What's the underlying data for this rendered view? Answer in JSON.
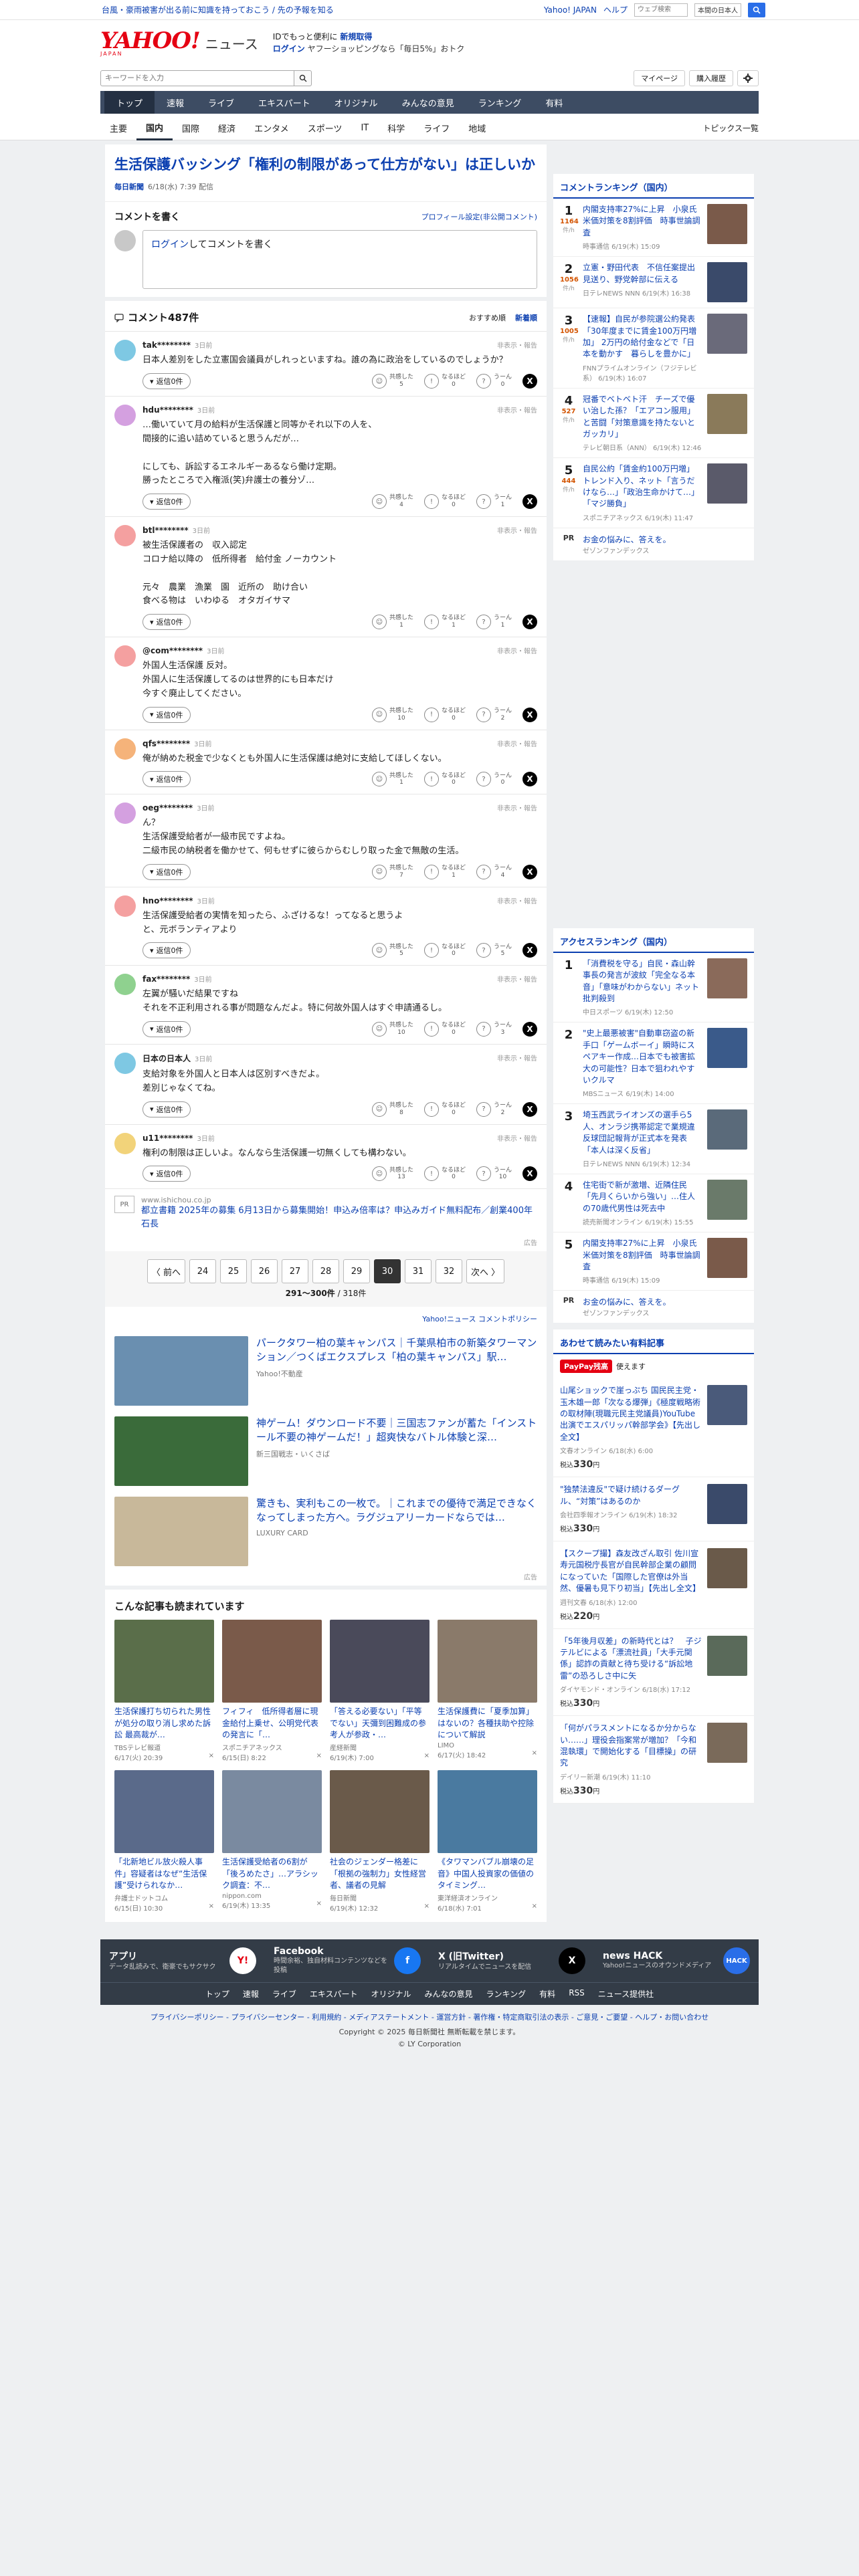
{
  "topbar": {
    "notice": "台風・豪雨被害が出る前に知識を持っておこう / 先の予報を知る",
    "yahoo_japan": "Yahoo! JAPAN",
    "help": "ヘルプ",
    "search_placeholder": "ウェブ検索",
    "scope": "本間の日本人"
  },
  "masthead": {
    "logo": "YAHOO!",
    "logo_sub": "JAPAN",
    "news": "ニュース",
    "promo_line1": "IDでもっと便利に",
    "promo_new": "新規取得",
    "promo_login": "ログイン",
    "promo_line2": "ヤフーショッピングなら「毎日5%」おトク"
  },
  "search": {
    "placeholder": "キーワードを入力",
    "mypage": "マイページ",
    "history": "購入履歴"
  },
  "global_nav": [
    "トップ",
    "速報",
    "ライブ",
    "エキスパート",
    "オリジナル",
    "みんなの意見",
    "ランキング",
    "有料"
  ],
  "sub_nav": [
    "主要",
    "国内",
    "国際",
    "経済",
    "エンタメ",
    "スポーツ",
    "IT",
    "科学",
    "ライフ",
    "地域"
  ],
  "topics_list": "トピックス一覧",
  "article": {
    "title": "生活保護バッシング「権利の制限があって仕方がない」は正しいか",
    "source": "毎日新聞",
    "date": "6/18(水) 7:39 配信"
  },
  "comment_write": {
    "title": "コメントを書く",
    "profile": "プロフィール設定(非公開コメント)",
    "login": "ログイン",
    "placeholder_rest": "してコメントを書く"
  },
  "comments_header": {
    "count": "コメント487件",
    "sort_recommend": "おすすめ順",
    "sort_new": "新着順"
  },
  "labels": {
    "flag": "非表示・報告",
    "reply": "返信0件",
    "agree": "共感した",
    "insight": "なるほど",
    "hmm": "うーん"
  },
  "comments": [
    {
      "user": "tak********",
      "ago": "3日前",
      "color": "#7ec8e3",
      "text": "日本人差別をした立憲国会議員がしれっといますね。誰の為に政治をしているのでしょうか？",
      "agree": "5",
      "insight": "0",
      "hmm": "0"
    },
    {
      "user": "hdu********",
      "ago": "3日前",
      "color": "#d4a0e0",
      "text": "…働いていて月の給料が生活保護と同等かそれ以下の人を、\n間接的に追い詰めていると思うんだが…\n\nにしても、訴訟するエネルギーあるなら働け定期。\n勝ったところで入権派(笑)弁護士の養分ゾ…",
      "agree": "4",
      "insight": "0",
      "hmm": "1"
    },
    {
      "user": "btl********",
      "ago": "3日前",
      "color": "#f4a0a0",
      "text": "被生活保護者の　収入認定\nコロナ給以降の　低所得者　給付金 ノーカウント\n\n元々　農業　漁業　園　近所の　助け合い\n食べる物は　いわゆる　オタガイサマ",
      "agree": "1",
      "insight": "1",
      "hmm": "1"
    },
    {
      "user": "@com********",
      "ago": "3日前",
      "color": "#f4a0a0",
      "text": "外国人生活保護 反対。\n外国人に生活保護してるのは世界的にも日本だけ\n今すぐ廃止してください。",
      "agree": "10",
      "insight": "0",
      "hmm": "2"
    },
    {
      "user": "qfs********",
      "ago": "3日前",
      "color": "#f5b37a",
      "text": "俺が納めた税金で少なくとも外国人に生活保護は絶対に支給してほしくない。",
      "agree": "1",
      "insight": "0",
      "hmm": "0"
    },
    {
      "user": "oeg********",
      "ago": "3日前",
      "color": "#d4a0e0",
      "text": "ん？\n生活保護受給者が一級市民ですよね。\n二級市民の納税者を働かせて、何もせずに彼らからむしり取った金で無敵の生活。",
      "agree": "7",
      "insight": "1",
      "hmm": "4"
    },
    {
      "user": "hno********",
      "ago": "3日前",
      "color": "#f4a0a0",
      "text": "生活保護受給者の実情を知ったら、ふざけるな！ってなると思うよ\nと、元ボランティアより",
      "agree": "5",
      "insight": "0",
      "hmm": "5"
    },
    {
      "user": "fax********",
      "ago": "3日前",
      "color": "#8fd18f",
      "text": "左翼が騒いだ結果ですね\nそれを不正利用される事が問題なんだよ。特に何故外国人はすぐ申請通るし。",
      "agree": "10",
      "insight": "0",
      "hmm": "3"
    },
    {
      "user": "日本の日本人",
      "ago": "3日前",
      "color": "#7ec8e3",
      "text": "支給対象を外国人と日本人は区別すべきだよ。\n差別じゃなくてね。",
      "agree": "8",
      "insight": "0",
      "hmm": "2"
    },
    {
      "user": "u11********",
      "ago": "3日前",
      "color": "#f2d37a",
      "text": "権利の制限は正しいよ。なんなら生活保護一切無くしても構わない。",
      "agree": "13",
      "insight": "0",
      "hmm": "10"
    }
  ],
  "comment_ad": {
    "label": "PR",
    "url": "www.ishichou.co.jp",
    "text": "都立書籍 2025年の募集 6月13日から募集開始！申込み倍率は？申込みガイド無料配布／創業400年石長",
    "ad": "広告"
  },
  "pager": {
    "prev": "〈 前へ",
    "pages": [
      "24",
      "25",
      "26",
      "27",
      "28",
      "29",
      "30",
      "31",
      "32"
    ],
    "current": "30",
    "next": "次へ 〉",
    "range": "291〜300件",
    "total": "/ 318件"
  },
  "policy": "Yahoo!ニュース コメントポリシー",
  "natives": [
    {
      "title": "パークタワー柏の葉キャンパス｜千葉県柏市の新築タワーマンション／つくばエクスプレス「柏の葉キャンパス」駅…",
      "src": "Yahoo!不動産",
      "img": "#6a8fb0"
    },
    {
      "title": "神ゲーム！ダウンロード不要｜三国志ファンが蓄た「インストール不要の神ゲームだ！」超爽快なバトル体験と深…",
      "src": "新三国戦志・いくさば",
      "img": "#3a6b3a"
    },
    {
      "title": "驚きも、実利もこの一枚で。｜これまでの優待で満足できなくなってしまった方へ。ラグジュアリーカードならでは…",
      "src": "LUXURY CARD",
      "img": "#c8b89a"
    }
  ],
  "natives_ad": "広告",
  "also_read": {
    "title": "こんな記事も読まれています",
    "items": [
      {
        "title": "生活保護打ち切られた男性が処分の取り消し求めた訴訟 最高裁が…",
        "src": "TBSテレビ報道",
        "date": "6/17(火) 20:39",
        "img": "#5a6e4a"
      },
      {
        "title": "フィフィ　低所得者層に現金給付上乗せ、公明党代表の発言に「…",
        "src": "スポニチアネックス",
        "date": "6/15(日) 8:22",
        "img": "#7a5a4a"
      },
      {
        "title": "「答える必要ない」「平等でない」天彌到困難成の参考人が参政・…",
        "src": "産経新聞",
        "date": "6/19(木) 7:00",
        "img": "#4a4a5a"
      },
      {
        "title": "生活保護費に「夏季加算」はないの？各種扶助や控除について解説",
        "src": "LIMO",
        "date": "6/17(火) 18:42",
        "img": "#8a7a6a"
      },
      {
        "title": "「北新地ビル放火殺人事件」容疑者はなぜ“生活保護”受けられなか…",
        "src": "弁護士ドットコム",
        "date": "6/15(日) 10:30",
        "img": "#5a6a8a"
      },
      {
        "title": "生活保護受給者の6割が「後ろめたさ」…アラシック調査：不…",
        "src": "nippon.com",
        "date": "6/19(木) 13:35",
        "img": "#7a8aa0"
      },
      {
        "title": "社会のジェンダー格差に「根拠の強制力」女性経営者、議者の見解",
        "src": "毎日新聞",
        "date": "6/19(木) 12:32",
        "img": "#6a5a4a"
      },
      {
        "title": "《タワマンバブル崩壊の足音》中国人投資家の価値のタイミング…",
        "src": "東洋経済オンライン",
        "date": "6/18(水) 7:01",
        "img": "#4a7aa0"
      }
    ]
  },
  "ranking_comment": {
    "title": "コメントランキング（国内）",
    "items": [
      {
        "title": "内閣支持率27%に上昇　小泉氏米価対策を8割評価　時事世論調査",
        "count": "1164",
        "src": "時事通信 6/19(木) 15:09",
        "img": "#7a5a4a"
      },
      {
        "title": "立憲・野田代表　不信任案提出見送り、野党幹部に伝える",
        "count": "1056",
        "src": "日テレNEWS NNN 6/19(木) 16:38",
        "img": "#3a4a6a"
      },
      {
        "title": "【速報】自民が参院選公約発表「30年度までに賃金100万円増加」 2万円の給付金などで「日本を動かす　暮らしを豊かに」",
        "count": "1005",
        "src": "FNNプライムオンライン（フジテレビ系） 6/19(木) 16:07",
        "img": "#6a6a7a"
      },
      {
        "title": "冠番でベトベト汗　チーズで優い治した孫？「エアコン服用」と苦闘「対策意識を持たないとガッカリ」",
        "count": "527",
        "src": "テレビ朝日系（ANN） 6/19(木) 12:46",
        "img": "#8a7a5a"
      },
      {
        "title": "自民公約「賃金約100万円増」トレンド入り、ネット「言うだけなら…」「政治生命かけて…」「マジ勝負」",
        "count": "444",
        "src": "スポニチアネックス 6/19(木) 11:47",
        "img": "#5a5a6a"
      }
    ],
    "unit": "件/h"
  },
  "ranking_comment_pr": {
    "label": "PR",
    "title": "お金の悩みに、答えを。",
    "src": "ゼゾンファンデックス"
  },
  "ranking_access": {
    "title": "アクセスランキング（国内）",
    "items": [
      {
        "title": "「消費税を守る」自民・森山幹事長の発言が波紋「完全なる本音」「意味がわからない」ネット批判殺到",
        "src": "中日スポーツ 6/19(木) 12:50",
        "img": "#8a6a5a"
      },
      {
        "title": "\"史上最悪被害\"自動車窃盗の新手口「ゲームボーイ」瞬時にスペアキー作成…日本でも被害拡大の可能性？日本で狙われやすいクルマ",
        "src": "MBSニュース 6/19(木) 14:00",
        "img": "#3a5a8a"
      },
      {
        "title": "埼玉西武ライオンズの選手ら5人、オンラジ携帯認定で業規違反球団記報背が正式本を発表「本人は深く反省」",
        "src": "日テレNEWS NNN 6/19(木) 12:34",
        "img": "#5a6a7a"
      },
      {
        "title": "住宅街で新が激増、近隣住民「先月くらいから強い」…住人の70歳代男性は死去中",
        "src": "読売新聞オンライン 6/19(木) 15:55",
        "img": "#6a7a6a"
      },
      {
        "title": "内閣支持率27%に上昇　小泉氏米価対策を8割評価　時事世論調査",
        "src": "時事通信 6/19(木) 15:09",
        "img": "#7a5a4a"
      }
    ]
  },
  "ranking_access_pr": {
    "label": "PR",
    "title": "お金の悩みに、答えを。",
    "src": "ゼゾンファンデックス"
  },
  "paid": {
    "title": "あわせて読みたい有料記事",
    "paypay": "PayPay残高",
    "paypay_text": "使えます",
    "items": [
      {
        "title": "山尾ショックで崖っぷち 国民民主党・玉木雄一郎「次なる爆弾」《極度戦略術の取材陣(現職元民主党議員)YouTube出演でエスパリッパ幹部学会》【先出し全文】",
        "src": "文春オンライン 6/18(水) 6:00",
        "price": "330",
        "img": "#4a5a7a"
      },
      {
        "title": "\"独禁法違反\"で疑け続けるダーグル、“対策”はあるのか",
        "src": "会社四季報オンライン 6/19(木) 18:32",
        "price": "330",
        "img": "#3a4a6a"
      },
      {
        "title": "【スクープ撮】森友改ざん取引 佐川宣寿元国税庁長官が自民幹部企業の顧問になっていた「国際した官僚は外当然、優暑も見下り初当」【先出し全文】",
        "src": "週刊文春 6/18(水) 12:00",
        "price": "220",
        "img": "#6a5a4a"
      },
      {
        "title": "「5年後月収差」の新時代とは？　子ジテルビによる「漂流社員」「大手元関係」認詐の貢献と待ち受ける“訴訟地雷”の恐ろしさ中に矢",
        "src": "ダイヤモンド・オンライン 6/18(水) 17:12",
        "price": "330",
        "img": "#5a6a5a"
      },
      {
        "title": "「何がパラスメントになるか分からない……」理役会指案常が増加？「今和混執環」で開始化する「目標操」の研究",
        "src": "デイリー新潮 6/19(木) 11:10",
        "price": "330",
        "img": "#7a6a5a"
      }
    ],
    "price_label": "税込",
    "yen": "円"
  },
  "footer": {
    "apps": [
      {
        "name": "アプリ",
        "desc": "データ乱読みで、衛豪でもサクサク",
        "icon": "Y!",
        "color": "#fff"
      },
      {
        "name": "Facebook",
        "desc": "時間余裕、独自材料コンテンツなどを投稿",
        "icon": "f",
        "color": "#1877f2"
      },
      {
        "name": "X (旧Twitter)",
        "desc": "リアルタイムでニュースを配信",
        "icon": "X",
        "color": "#000"
      },
      {
        "name": "news HACK",
        "desc": "Yahoo!ニュースのオウンドメディア",
        "icon": "HACK",
        "color": "#2a6ee8"
      }
    ],
    "nav": [
      "トップ",
      "速報",
      "ライブ",
      "エキスパート",
      "オリジナル",
      "みんなの意見",
      "ランキング",
      "有料",
      "RSS",
      "ニュース提供社"
    ],
    "links": "プライバシーポリシー - プライバシーセンター - 利用規約 - メディアステートメント - 運営方針 - 著作権・特定商取引法の表示 - ご意見・ご要望 - ヘルプ・お問い合わせ",
    "copy1": "Copyright © 2025 毎日新聞社 無断転載を禁じます。",
    "copy2": "© LY Corporation"
  }
}
